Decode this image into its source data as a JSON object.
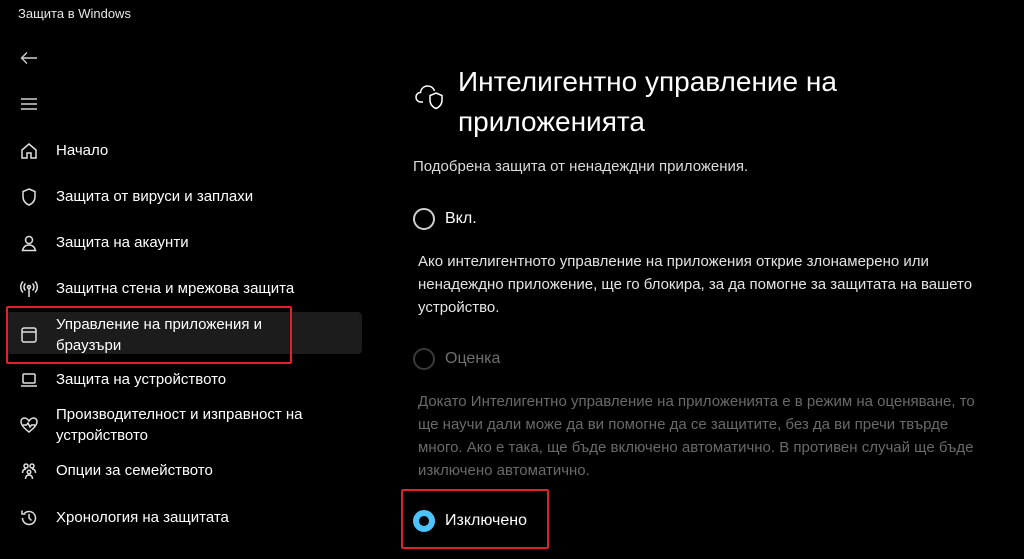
{
  "window": {
    "title": "Защита в Windows"
  },
  "sidebar": {
    "items": [
      {
        "label": "Начало",
        "icon": "home-icon"
      },
      {
        "label": "Защита от вируси и заплахи",
        "icon": "shield-icon"
      },
      {
        "label": "Защита на акаунти",
        "icon": "person-icon"
      },
      {
        "label": "Защитна стена и мрежова защита",
        "icon": "antenna-icon"
      },
      {
        "label": "Управление на приложения и браузъри",
        "icon": "app-window-icon",
        "selected": true
      },
      {
        "label": "Защита на устройството",
        "icon": "laptop-icon"
      },
      {
        "label": "Производителност и изправност на устройството",
        "icon": "heart-pulse-icon"
      },
      {
        "label": "Опции за семейството",
        "icon": "family-icon"
      },
      {
        "label": "Хронология на защитата",
        "icon": "history-icon"
      }
    ]
  },
  "main": {
    "title": "Интелигентно управление на приложенията",
    "subtitle": "Подобрена защита от ненадеждни приложения.",
    "options": [
      {
        "label": "Вкл.",
        "state": "unchecked",
        "description": "Ако интелигентното управление на приложения открие злонамерено или ненадеждно приложение, ще го блокира, за да помогне за защитата на вашето устройство."
      },
      {
        "label": "Оценка",
        "state": "disabled",
        "description": "Докато Интелигентно управление на приложенията е в режим на оценяване, то ще научи дали може да ви помогне да се защитите, без да ви пречи твърде много. Ако е така, ще бъде включено автоматично. В противен случай ще бъде изключено автоматично."
      },
      {
        "label": "Изключено",
        "state": "checked"
      }
    ]
  },
  "colors": {
    "accent": "#4cc2ff",
    "highlight_box": "#e0202a",
    "background": "#000000"
  }
}
